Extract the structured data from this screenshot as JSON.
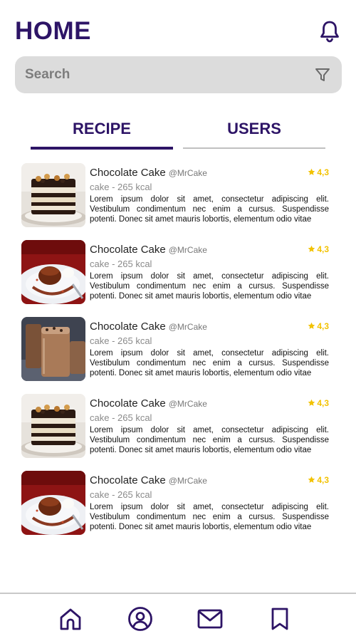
{
  "header": {
    "title": "HOME",
    "icon": "bell-icon"
  },
  "search": {
    "placeholder": "Search",
    "value": "",
    "icon": "filter-icon"
  },
  "tabs": [
    {
      "label": "RECIPE",
      "active": true
    },
    {
      "label": "USERS",
      "active": false
    }
  ],
  "recipes": [
    {
      "name": "Chocolate Cake",
      "user": "@MrCake",
      "rating": "4,3",
      "meta": "cake - 265 kcal",
      "description": "Lorem ipsum dolor sit amet, consectetur adipiscing elit. Vestibulum condimentum nec enim a cursus. Suspendisse potenti. Donec sit amet mauris lobortis, elementum odio vitae",
      "image": "layered-cake-photo"
    },
    {
      "name": "Chocolate Cake",
      "user": "@MrCake",
      "rating": "4,3",
      "meta": "cake - 265 kcal",
      "description": "Lorem ipsum dolor sit amet, consectetur adipiscing elit. Vestibulum condimentum nec enim a cursus. Suspendisse potenti. Donec sit amet mauris lobortis, elementum odio vitae",
      "image": "lava-cake-photo"
    },
    {
      "name": "Chocolate Cake",
      "user": "@MrCake",
      "rating": "4,3",
      "meta": "cake - 265 kcal",
      "description": "Lorem ipsum dolor sit amet, consectetur adipiscing elit. Vestibulum condimentum nec enim a cursus. Suspendisse potenti. Donec sit amet mauris lobortis, elementum odio vitae",
      "image": "chocolate-shake-photo"
    },
    {
      "name": "Chocolate Cake",
      "user": "@MrCake",
      "rating": "4,3",
      "meta": "cake - 265 kcal",
      "description": "Lorem ipsum dolor sit amet, consectetur adipiscing elit. Vestibulum condimentum nec enim a cursus. Suspendisse potenti. Donec sit amet mauris lobortis, elementum odio vitae",
      "image": "layered-cake-photo"
    },
    {
      "name": "Chocolate Cake",
      "user": "@MrCake",
      "rating": "4,3",
      "meta": "cake - 265 kcal",
      "description": "Lorem ipsum dolor sit amet, consectetur adipiscing elit. Vestibulum condimentum nec enim a cursus. Suspendisse potenti. Donec sit amet mauris lobortis, elementum odio vitae",
      "image": "lava-cake-photo"
    }
  ],
  "bottom_nav": [
    "home-icon",
    "profile-icon",
    "mail-icon",
    "bookmark-icon"
  ],
  "colors": {
    "primary": "#2d1466",
    "rating": "#f2c200",
    "search_bg": "#dcdcdc",
    "divider": "#c8c8c8"
  }
}
